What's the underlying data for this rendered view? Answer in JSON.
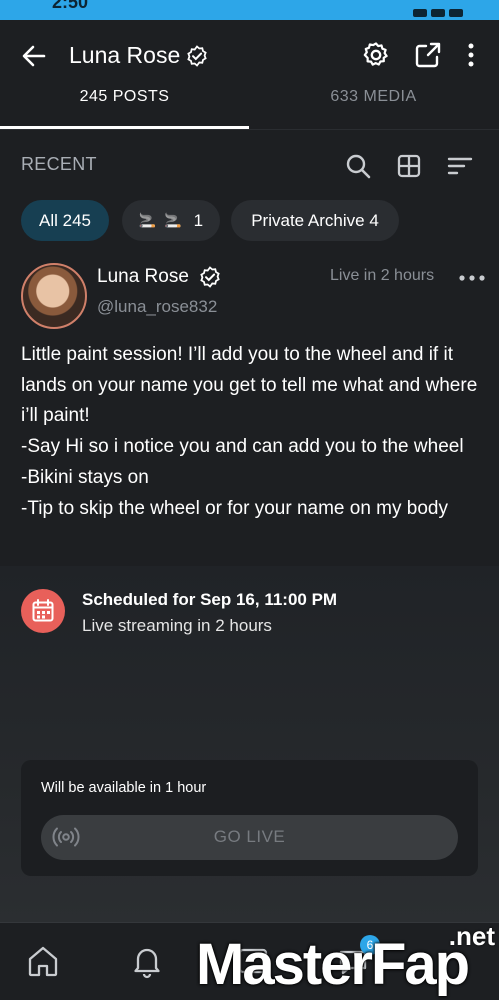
{
  "status_bar": {
    "time": "2:50",
    "color": "#2da6e8"
  },
  "app_bar": {
    "title": "Luna Rose"
  },
  "tabs": [
    {
      "label": "245 POSTS",
      "active": true
    },
    {
      "label": "633 MEDIA",
      "active": false
    }
  ],
  "filter_row": {
    "label": "RECENT"
  },
  "chips": [
    {
      "label": "All 245",
      "active": true
    },
    {
      "emoji": "🚬 🚬",
      "label": "1",
      "active": false
    },
    {
      "label": "Private Archive 4",
      "active": false
    }
  ],
  "post": {
    "author": "Luna Rose",
    "handle": "@luna_rose832",
    "time": "Live in 2 hours",
    "text": "Little paint session! I’ll add you to the wheel and if it lands on your name you get to tell me what and where i’ll paint!\n-Say Hi so i notice you and can add you to the wheel\n-Bikini stays on\n-Tip to skip the wheel or for your name on my body"
  },
  "schedule": {
    "title": "Scheduled for Sep 16, 11:00 PM",
    "subtitle": "Live streaming in 2 hours",
    "icon_color": "#e8605a"
  },
  "live_card": {
    "availability": "Will be available in 1 hour",
    "button_label": "GO LIVE"
  },
  "bottom_nav": {
    "badge_count": "6"
  },
  "watermark": {
    "main": "MasterFap",
    "suffix": ".net"
  }
}
